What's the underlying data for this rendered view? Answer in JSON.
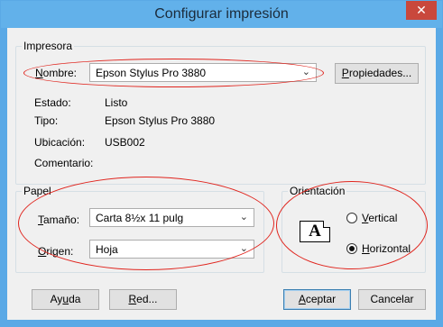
{
  "window": {
    "title": "Configurar impresión",
    "close_glyph": "✕"
  },
  "printer": {
    "group_label": "Impresora",
    "name_label_u": "N",
    "name_label_rest": "ombre:",
    "name_value": "Epson Stylus Pro 3880",
    "properties_button_u": "P",
    "properties_button_rest": "ropiedades...",
    "status_label": "Estado:",
    "status_value": "Listo",
    "type_label": "Tipo:",
    "type_value": "Epson Stylus Pro 3880",
    "location_label": "Ubicación:",
    "location_value": "USB002",
    "comment_label": "Comentario:",
    "comment_value": ""
  },
  "paper": {
    "group_label": "Papel",
    "size_label_u": "T",
    "size_label_rest": "amaño:",
    "size_value": "Carta 8½x 11 pulg",
    "source_label_u": "O",
    "source_label_rest": "rigen:",
    "source_value": "Hoja"
  },
  "orientation": {
    "group_label": "Orientación",
    "icon_letter": "A",
    "vertical_u": "V",
    "vertical_rest": "ertical",
    "horizontal_u": "H",
    "horizontal_rest": "orizontal",
    "selected": "Horizontal"
  },
  "buttons": {
    "help_pre": "Ay",
    "help_u": "u",
    "help_post": "da",
    "network_u": "R",
    "network_rest": "ed...",
    "ok_u": "A",
    "ok_rest": "ceptar",
    "cancel": "Cancelar"
  },
  "colors": {
    "titlebar": "#62b1ea",
    "close": "#c9483c",
    "highlight_ellipse": "#e0241d"
  }
}
